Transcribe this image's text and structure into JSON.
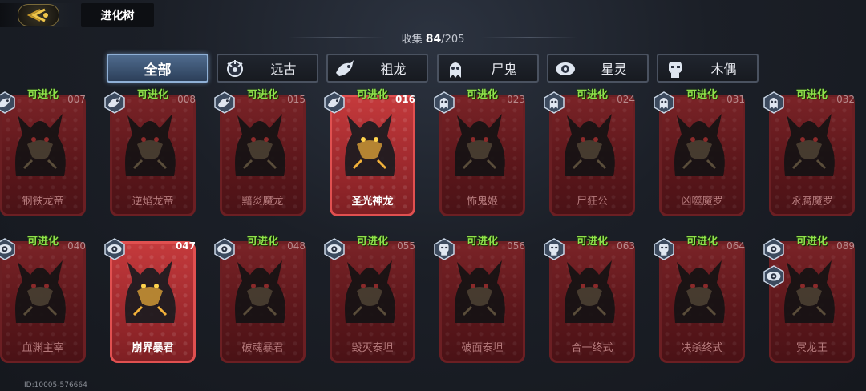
{
  "header": {
    "back_icon": "back-arrow-emblem-icon",
    "title": "进化树",
    "collect_label": "收集",
    "collect_count": "84",
    "collect_total": "/205"
  },
  "tabs": [
    {
      "label": "全部",
      "active": true,
      "icon": ""
    },
    {
      "label": "远古",
      "active": false,
      "icon": "ancient-icon"
    },
    {
      "label": "祖龙",
      "active": false,
      "icon": "dragon-icon"
    },
    {
      "label": "尸鬼",
      "active": false,
      "icon": "ghoul-icon"
    },
    {
      "label": "星灵",
      "active": false,
      "icon": "astral-icon"
    },
    {
      "label": "木偶",
      "active": false,
      "icon": "puppet-icon"
    }
  ],
  "evolve_label": "可进化",
  "cards": [
    {
      "num": "007",
      "name": "钢铁龙帝",
      "evolvable": true,
      "bright": false,
      "badge": "dragon-icon"
    },
    {
      "num": "008",
      "name": "逆焰龙帝",
      "evolvable": true,
      "bright": false,
      "badge": "dragon-icon"
    },
    {
      "num": "015",
      "name": "黯炎魔龙",
      "evolvable": true,
      "bright": false,
      "badge": "dragon-icon"
    },
    {
      "num": "016",
      "name": "圣光神龙",
      "evolvable": true,
      "bright": true,
      "badge": "dragon-icon"
    },
    {
      "num": "023",
      "name": "怖鬼姬",
      "evolvable": true,
      "bright": false,
      "badge": "ghoul-icon"
    },
    {
      "num": "024",
      "name": "尸狂公",
      "evolvable": true,
      "bright": false,
      "badge": "ghoul-icon"
    },
    {
      "num": "031",
      "name": "凶噬魔罗",
      "evolvable": true,
      "bright": false,
      "badge": "ghoul-icon"
    },
    {
      "num": "032",
      "name": "永腐魔罗",
      "evolvable": true,
      "bright": false,
      "badge": "ghoul-icon"
    },
    {
      "num": "040",
      "name": "血渊主宰",
      "evolvable": true,
      "bright": false,
      "badge": "astral-icon"
    },
    {
      "num": "047",
      "name": "崩界暴君",
      "evolvable": false,
      "bright": true,
      "badge": "astral-icon"
    },
    {
      "num": "048",
      "name": "破魂暴君",
      "evolvable": true,
      "bright": false,
      "badge": "astral-icon"
    },
    {
      "num": "055",
      "name": "毁灭泰坦",
      "evolvable": true,
      "bright": false,
      "badge": "astral-icon"
    },
    {
      "num": "056",
      "name": "破面泰坦",
      "evolvable": true,
      "bright": false,
      "badge": "puppet-icon"
    },
    {
      "num": "063",
      "name": "合一终式",
      "evolvable": true,
      "bright": false,
      "badge": "puppet-icon"
    },
    {
      "num": "064",
      "name": "决杀终式",
      "evolvable": true,
      "bright": false,
      "badge": "puppet-icon"
    },
    {
      "num": "089",
      "name": "冥龙王",
      "evolvable": true,
      "bright": false,
      "badge": "astral-icon",
      "badge2": "astral-icon"
    }
  ],
  "footer": {
    "id_text": "ID:10005-576664"
  },
  "colors": {
    "evolve_green": "#8ee24a",
    "card_red": "#7a2327",
    "card_bright_red": "#c53a3c",
    "tab_active": "#4f6b8e"
  }
}
